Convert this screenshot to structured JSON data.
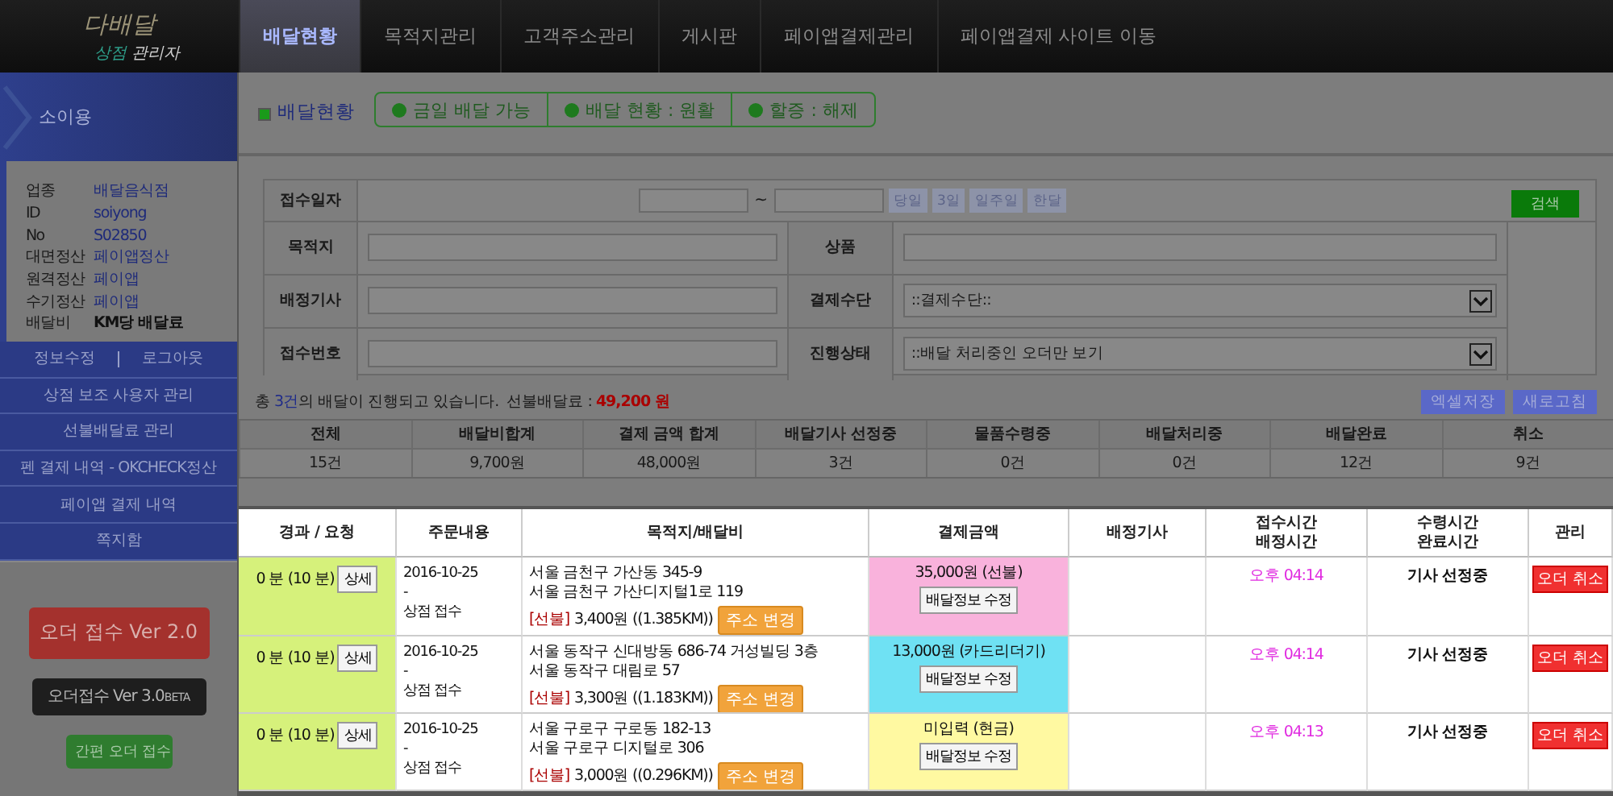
{
  "logo": {
    "title": "다배달",
    "subtitle_accent": "상점",
    "subtitle": "관리자"
  },
  "nav": [
    {
      "label": "배달현황",
      "selected": true
    },
    {
      "label": "목적지관리",
      "selected": false
    },
    {
      "label": "고객주소관리",
      "selected": false
    },
    {
      "label": "게시판",
      "selected": false
    },
    {
      "label": "페이앱결제관리",
      "selected": false
    },
    {
      "label": "페이앱결제 사이트 이동",
      "selected": false
    }
  ],
  "sidebar": {
    "user": "소이용",
    "info": [
      {
        "label": "업종",
        "value": "배달음식점",
        "highlight": true
      },
      {
        "label": "ID",
        "value": "soiyong",
        "highlight": true
      },
      {
        "label": "No",
        "value": "S02850",
        "highlight": true
      },
      {
        "label": "대면정산",
        "value": "페이앱정산",
        "highlight": true
      },
      {
        "label": "원격정산",
        "value": "페이앱",
        "highlight": true
      },
      {
        "label": "수기정산",
        "value": "페이앱",
        "highlight": true
      },
      {
        "label": "배달비",
        "value": "KM당 배달료",
        "highlight": false
      }
    ],
    "account_links": [
      "정보수정",
      "로그아웃"
    ],
    "menu": [
      "상점 보조 사용자 관리",
      "선불배달료 관리",
      "펜 결제 내역 - OKCHECK정산",
      "페이앱 결제 내역",
      "쪽지함"
    ],
    "order_buttons": [
      {
        "kind": "primary",
        "label": "오더 접수 Ver 2.0"
      },
      {
        "kind": "dark",
        "label": "오더접수 Ver 3.0",
        "badge": "BETA"
      },
      {
        "kind": "simple",
        "label": "간편 오더 접수"
      }
    ]
  },
  "page_title": "배달현황",
  "status": [
    "금일 배달 가능",
    "배달 현황 : 원활",
    "할증 : 해제"
  ],
  "search": {
    "date_label": "접수일자",
    "date_separator": "~",
    "quick_ranges": [
      "당일",
      "3일",
      "일주일",
      "한달"
    ],
    "submit": "검색",
    "rows": [
      {
        "label": "목적지",
        "right": {
          "label": "상품",
          "kind": "input"
        }
      },
      {
        "label": "배정기사",
        "right": {
          "label": "결제수단",
          "kind": "select",
          "value": "::결제수단::"
        }
      },
      {
        "label": "접수번호",
        "right": {
          "label": "진행상태",
          "kind": "select",
          "value": "::배달 처리중인 오더만 보기"
        }
      }
    ]
  },
  "summary": {
    "before": "총 ",
    "count": "3건",
    "after": "의 배달이 진행되고 있습니다.",
    "prepaid_label": "선불배달료 :",
    "prepaid_amount": "49,200 원"
  },
  "toolbar": [
    "엑셀저장",
    "새로고침"
  ],
  "stats": {
    "columns": [
      "전체",
      "배달비합계",
      "결제 금액 합계",
      "배달기사 선정중",
      "물품수령중",
      "배달처리중",
      "배달완료",
      "취소"
    ],
    "values": [
      "15건",
      "9,700원",
      "48,000원",
      "3건",
      "0건",
      "0건",
      "12건",
      "9건"
    ]
  },
  "orders": {
    "columns": [
      [
        "경과 / 요청"
      ],
      [
        "주문내용"
      ],
      [
        "목적지/배달비"
      ],
      [
        "결제금액"
      ],
      [
        "배정기사"
      ],
      [
        "접수시간",
        "배정시간"
      ],
      [
        "수령시간",
        "완료시간"
      ],
      [
        "관리"
      ]
    ],
    "rows": [
      {
        "elapsed": "0 분 (10 분)",
        "detail": "상세",
        "date": "2016-10-25",
        "dash": "-",
        "source": "상점 접수",
        "address": [
          "서울 금천구 가산동 345-9",
          "서울 금천구 가산디지털1로 119"
        ],
        "fee_tag": "[선불]",
        "fee": "3,400원 ((1.385KM))",
        "change": "주소 변경",
        "payment": {
          "amount": "35,000원 (선불)",
          "color": "#f9b2dc"
        },
        "edit": "배달정보 수정",
        "time": "오후 04:14",
        "status": "기사 선정중",
        "cancel": "오더 취소"
      },
      {
        "elapsed": "0 분 (10 분)",
        "detail": "상세",
        "date": "2016-10-25",
        "dash": "-",
        "source": "상점 접수",
        "address": [
          "서울 동작구 신대방동 686-74 거성빌딩 3층",
          "서울 동작구 대림로 57"
        ],
        "fee_tag": "[선불]",
        "fee": "3,300원 ((1.183KM))",
        "change": "주소 변경",
        "payment": {
          "amount": "13,000원 (카드리더기)",
          "color": "#6fe1f3"
        },
        "edit": "배달정보 수정",
        "time": "오후 04:14",
        "status": "기사 선정중",
        "cancel": "오더 취소"
      },
      {
        "elapsed": "0 분 (10 분)",
        "detail": "상세",
        "date": "2016-10-25",
        "dash": "-",
        "source": "상점 접수",
        "address": [
          "서울 구로구 구로동 182-13",
          "서울 구로구 디지털로 306"
        ],
        "fee_tag": "[선불]",
        "fee": "3,000원 ((0.296KM))",
        "change": "주소 변경",
        "payment": {
          "amount": "미입력 (현금)",
          "color": "#fff9a1"
        },
        "edit": "배달정보 수정",
        "time": "오후 04:13",
        "status": "기사 선정중",
        "cancel": "오더 취소"
      }
    ]
  }
}
